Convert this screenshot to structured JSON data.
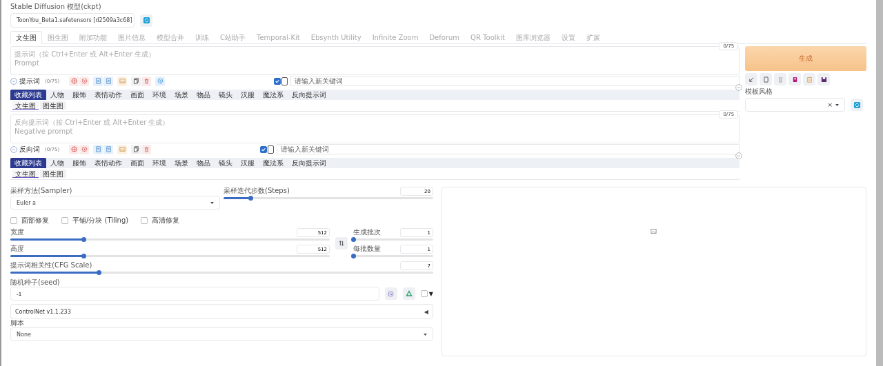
{
  "model": {
    "label": "Stable Diffusion 模型(ckpt)",
    "value": "ToonYou_Beta1.safetensors [d2509a3c68]"
  },
  "tabs": [
    {
      "label": "文生图",
      "selected": true
    },
    {
      "label": "图生图",
      "selected": false
    },
    {
      "label": "附加功能",
      "selected": false
    },
    {
      "label": "图片信息",
      "selected": false
    },
    {
      "label": "模型合并",
      "selected": false
    },
    {
      "label": "训练",
      "selected": false
    },
    {
      "label": "C站助手",
      "selected": false
    },
    {
      "label": "Temporal-Kit",
      "selected": false
    },
    {
      "label": "Ebsynth Utility",
      "selected": false
    },
    {
      "label": "Infinite Zoom",
      "selected": false
    },
    {
      "label": "Deforum",
      "selected": false
    },
    {
      "label": "QR Toolkit",
      "selected": false
    },
    {
      "label": "图库浏览器",
      "selected": false
    },
    {
      "label": "设置",
      "selected": false
    },
    {
      "label": "扩展",
      "selected": false
    }
  ],
  "prompts": [
    {
      "kind": "positive",
      "placeholder": "提示词（按 Ctrl+Enter 或 Alt+Enter 生成）\nPrompt",
      "counter": "0/75",
      "title": "提示词",
      "count": "(0/75)",
      "keyword_checked": true,
      "keyword_toggle_on": false,
      "keyword_placeholder": "请输入新关键词",
      "categories": [
        {
          "label": "收藏列表",
          "selected": true
        },
        {
          "label": "人物",
          "selected": false
        },
        {
          "label": "服饰",
          "selected": false
        },
        {
          "label": "表情动作",
          "selected": false
        },
        {
          "label": "画面",
          "selected": false
        },
        {
          "label": "环境",
          "selected": false
        },
        {
          "label": "场景",
          "selected": false
        },
        {
          "label": "物品",
          "selected": false
        },
        {
          "label": "镜头",
          "selected": false
        },
        {
          "label": "汉服",
          "selected": false
        },
        {
          "label": "魔法系",
          "selected": false
        },
        {
          "label": "反向提示词",
          "selected": false
        }
      ],
      "subtabs": [
        {
          "label": "文生图",
          "selected": true
        },
        {
          "label": "图生图",
          "selected": false
        }
      ]
    },
    {
      "kind": "negative",
      "placeholder": "反向提示词（按 Ctrl+Enter 或 Alt+Enter 生成）\nNegative prompt",
      "counter": "0/75",
      "title": "反向词",
      "count": "(0/75)",
      "keyword_checked": true,
      "keyword_toggle_on": false,
      "keyword_placeholder": "请输入新关键词",
      "categories": [
        {
          "label": "收藏列表",
          "selected": true
        },
        {
          "label": "人物",
          "selected": false
        },
        {
          "label": "服饰",
          "selected": false
        },
        {
          "label": "表情动作",
          "selected": false
        },
        {
          "label": "画面",
          "selected": false
        },
        {
          "label": "环境",
          "selected": false
        },
        {
          "label": "场景",
          "selected": false
        },
        {
          "label": "物品",
          "selected": false
        },
        {
          "label": "镜头",
          "selected": false
        },
        {
          "label": "汉服",
          "selected": false
        },
        {
          "label": "魔法系",
          "selected": false
        },
        {
          "label": "反向提示词",
          "selected": false
        }
      ],
      "subtabs": [
        {
          "label": "文生图",
          "selected": true
        },
        {
          "label": "图生图",
          "selected": false
        }
      ]
    }
  ],
  "generate": {
    "label": "生成"
  },
  "style": {
    "label": "模板风格",
    "clear": "×"
  },
  "sampler": {
    "label": "采样方法(Sampler)",
    "value": "Euler a"
  },
  "steps": {
    "label": "采样迭代步数(Steps)",
    "value": "20",
    "level": 0.13
  },
  "options": [
    {
      "label": "面部修复",
      "checked": false
    },
    {
      "label": "平铺/分块 (Tiling)",
      "checked": false
    },
    {
      "label": "高清修复",
      "checked": false
    }
  ],
  "width": {
    "label": "宽度",
    "value": "512",
    "level": 0.23
  },
  "height": {
    "label": "高度",
    "value": "512",
    "level": 0.23
  },
  "batch_count": {
    "label": "生成批次",
    "value": "1",
    "level": 0
  },
  "batch_size": {
    "label": "每批数量",
    "value": "1",
    "level": 0
  },
  "cfg": {
    "label": "提示词相关性(CFG Scale)",
    "value": "7",
    "level": 0.21
  },
  "seed": {
    "label": "随机种子(seed)",
    "value": "-1",
    "extra_checked": false,
    "extra_arrow": "▼"
  },
  "controlnet": {
    "label": "ControlNet v1.1.233",
    "arrow": "◀"
  },
  "script": {
    "label": "脚本",
    "value": "None"
  }
}
